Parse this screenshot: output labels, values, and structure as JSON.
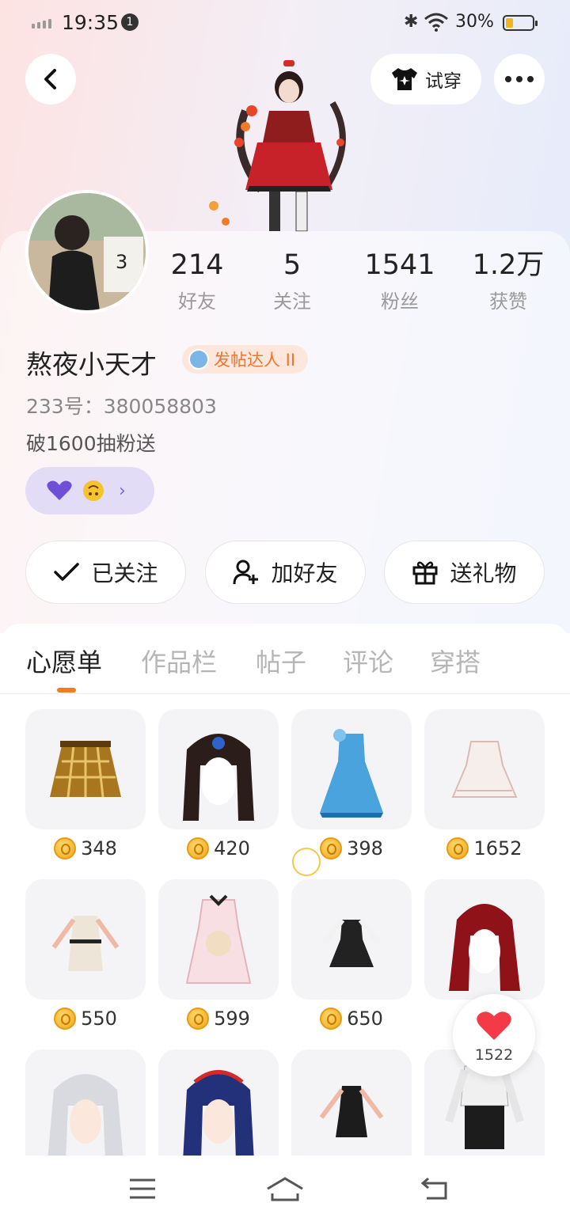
{
  "status_bar": {
    "time": "19:35",
    "notification_count": "1",
    "battery": "30%"
  },
  "header": {
    "tryon_label": "试穿"
  },
  "stats": [
    {
      "num": "214",
      "label": "好友"
    },
    {
      "num": "5",
      "label": "关注"
    },
    {
      "num": "1541",
      "label": "粉丝"
    },
    {
      "num": "1.2万",
      "label": "获赞"
    }
  ],
  "profile": {
    "nickname": "熬夜小天才",
    "badge": "发帖达人 II",
    "uid": "233号：380058803",
    "bio": "破1600抽粉送"
  },
  "actions": {
    "follow": "已关注",
    "add_friend": "加好友",
    "gift": "送礼物"
  },
  "tabs": [
    "心愿单",
    "作品栏",
    "帖子",
    "评论",
    "穿搭"
  ],
  "wishlist": [
    {
      "price": "348"
    },
    {
      "price": "420"
    },
    {
      "price": "398"
    },
    {
      "price": "1652"
    },
    {
      "price": "550"
    },
    {
      "price": "599"
    },
    {
      "price": "650"
    },
    {
      "price": ""
    },
    {
      "price": ""
    },
    {
      "price": ""
    },
    {
      "price": ""
    },
    {
      "price": ""
    }
  ],
  "like_fab": {
    "count": "1522"
  }
}
